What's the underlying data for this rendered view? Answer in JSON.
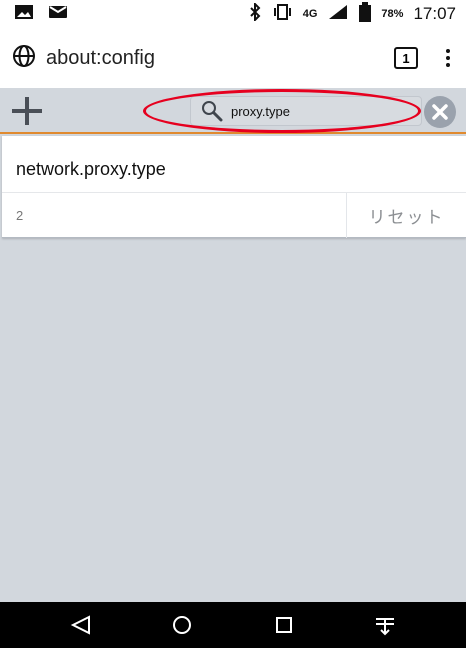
{
  "status_bar": {
    "left_icons": [
      "image-icon",
      "message-icon"
    ],
    "bluetooth": "bluetooth-icon",
    "vibration": "vibration-icon",
    "network": "4G",
    "signal": "signal-icon",
    "battery": "78%",
    "time": "17:07"
  },
  "browser": {
    "globe_icon": "globe-icon",
    "url": "about:config",
    "tab_count": "1",
    "menu_icon": "more-vertical-icon"
  },
  "filter": {
    "add_icon": "plus-icon",
    "search_icon": "search-icon",
    "query": "proxy.type",
    "clear_icon": "close-icon"
  },
  "preferences": [
    {
      "name": "network.proxy.type",
      "value": "2",
      "reset_label": "リセット"
    }
  ],
  "annotation": {
    "shape": "ellipse",
    "color": "#e6001f"
  },
  "colors": {
    "accent": "#e08a2f",
    "filter_background": "#d2d7dd",
    "annotation": "#e6001f"
  },
  "navigation": {
    "back_icon": "back-triangle-icon",
    "home_icon": "home-circle-icon",
    "recent_icon": "recent-square-icon",
    "drawer_icon": "notification-drawer-icon"
  }
}
